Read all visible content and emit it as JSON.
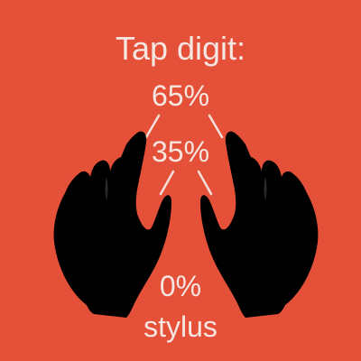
{
  "colors": {
    "background": "#e55039",
    "text": "#f6e6e1",
    "lines": "#f4e0da",
    "hands": "#000000"
  },
  "prompt": "Tap digit:",
  "options": {
    "high": "65%",
    "mid": "35%",
    "zero": "0%",
    "device": "stylus"
  },
  "icons": {
    "left": "left-hand-pointing-icon",
    "right": "right-hand-pointing-icon"
  }
}
